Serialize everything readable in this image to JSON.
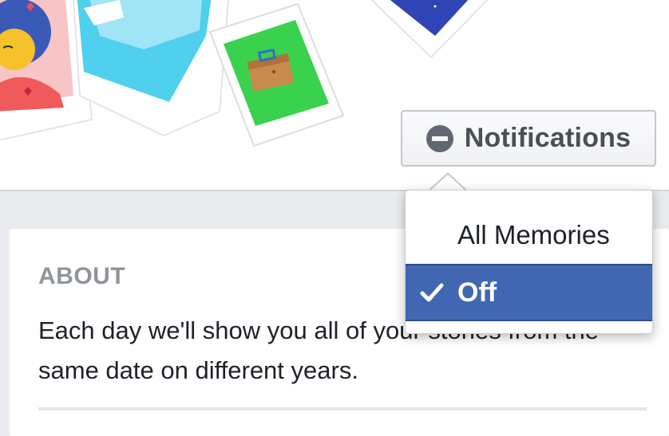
{
  "notifications_button": {
    "label": "Notifications",
    "icon": "minus-circle-icon"
  },
  "about": {
    "heading": "ABOUT",
    "body": "Each day we'll show you all of your stories from the same date on different years."
  },
  "dropdown": {
    "items": [
      {
        "label": "All Memories",
        "selected": false
      },
      {
        "label": "Off",
        "selected": true,
        "icon": "checkmark-icon"
      }
    ]
  },
  "colors": {
    "selected_bg": "#4267b2",
    "page_bg": "#e9ebee",
    "text_dark": "#1d2129",
    "heading_gray": "#90949c"
  }
}
